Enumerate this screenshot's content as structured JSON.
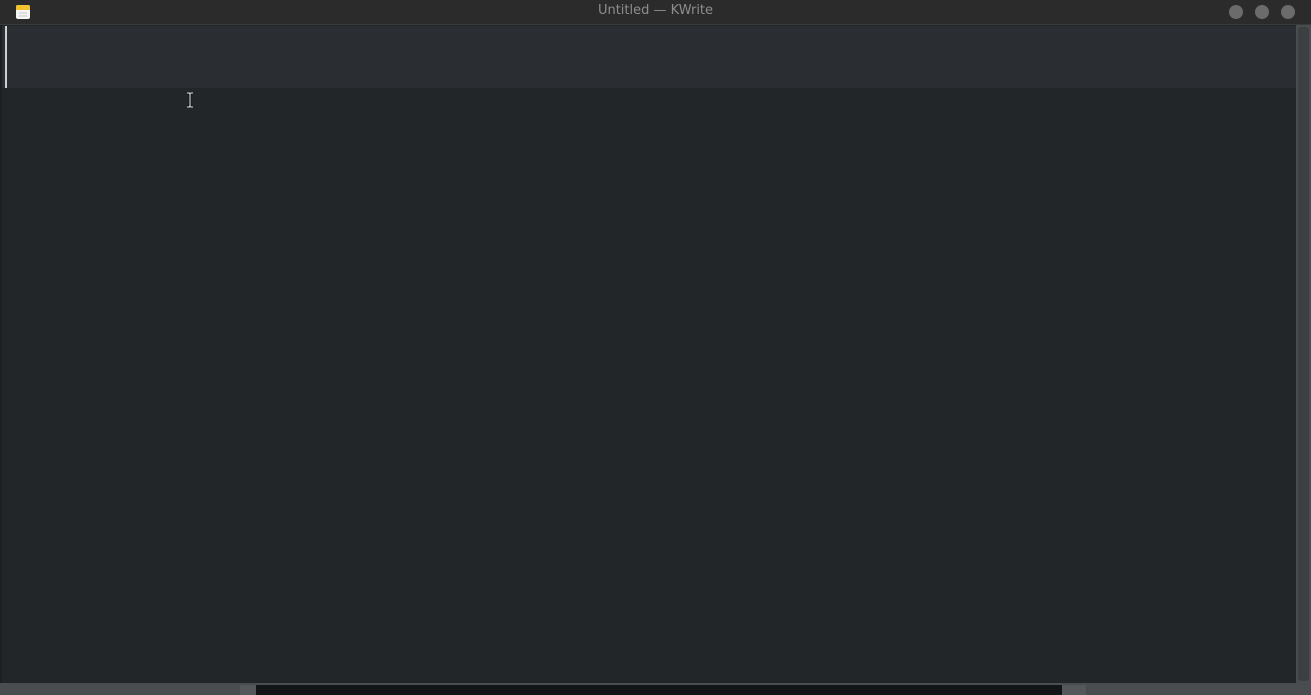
{
  "window": {
    "title": "Untitled — KWrite",
    "app_icon": "kwrite-notepad-icon",
    "controls": [
      "minimize-button",
      "maximize-button",
      "close-button"
    ]
  },
  "editor": {
    "content": "",
    "current_line_highlighted": true,
    "cursor": "ibeam-icon"
  },
  "colors": {
    "titlebar": "#2b2b2b",
    "title_text": "#8d8d8d",
    "editor_bg": "#232629",
    "current_line": "#2a2e32",
    "scrollbar": "#4a4d50",
    "window_control": "#6b6b6b"
  }
}
